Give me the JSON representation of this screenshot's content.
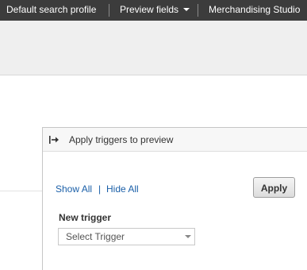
{
  "topbar": {
    "search_profile": "Default search profile",
    "preview_fields": "Preview fields",
    "merchandising_studio": "Merchandising Studio"
  },
  "panel": {
    "collapse_icon": "collapse-arrow-icon",
    "title": "Apply triggers to preview",
    "show_all": "Show All",
    "separator": "|",
    "hide_all": "Hide All",
    "apply_label": "Apply",
    "new_trigger_label": "New trigger",
    "select_trigger": {
      "value": "Select Trigger",
      "icon": "chevron-down-icon"
    }
  },
  "colors": {
    "topbar_bg": "#3c3c3c",
    "link": "#1a5fa8",
    "toolbar_bg": "#efefef"
  }
}
